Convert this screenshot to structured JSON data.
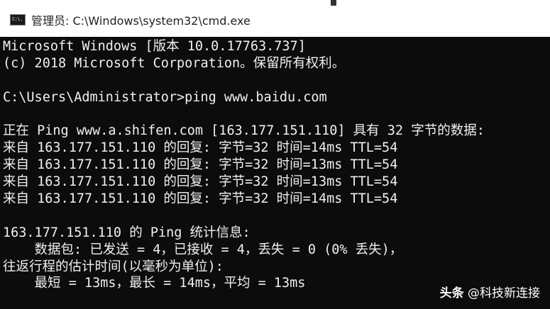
{
  "window": {
    "title": "管理员: C:\\Windows\\system32\\cmd.exe",
    "icon": "cmd-app-icon",
    "icon_text": "C:\\."
  },
  "console": {
    "lines": [
      "Microsoft Windows [版本 10.0.17763.737]",
      "(c) 2018 Microsoft Corporation。保留所有权利。",
      "",
      "C:\\Users\\Administrator>ping www.baidu.com",
      "",
      "正在 Ping www.a.shifen.com [163.177.151.110] 具有 32 字节的数据:",
      "来自 163.177.151.110 的回复: 字节=32 时间=14ms TTL=54",
      "来自 163.177.151.110 的回复: 字节=32 时间=13ms TTL=54",
      "来自 163.177.151.110 的回复: 字节=32 时间=13ms TTL=54",
      "来自 163.177.151.110 的回复: 字节=32 时间=14ms TTL=54",
      "",
      "163.177.151.110 的 Ping 统计信息:",
      "    数据包: 已发送 = 4，已接收 = 4，丢失 = 0 (0% 丢失)，",
      "往返行程的估计时间(以毫秒为单位):",
      "    最短 = 13ms，最长 = 14ms，平均 = 13ms"
    ]
  },
  "watermark": {
    "logo": "头条",
    "handle": " @科技新连接"
  },
  "colors": {
    "console_bg": "#0c0c0c",
    "console_fg": "#f0f0f0",
    "titlebar_bg": "#ffffff"
  }
}
